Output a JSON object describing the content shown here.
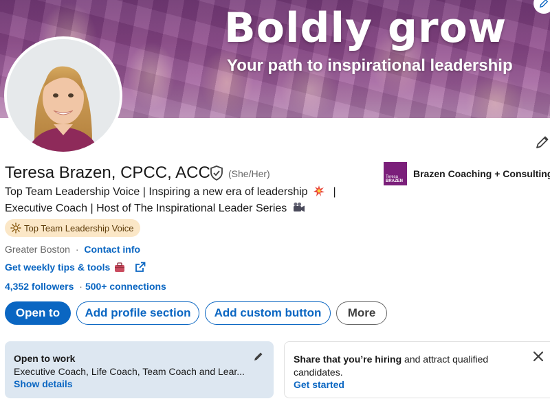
{
  "banner": {
    "title": "Boldly grow",
    "subtitle": "Your path to inspirational leadership"
  },
  "profile": {
    "name": "Teresa Brazen, CPCC, ACC",
    "pronouns": "(She/Her)",
    "headline_line1": "Top Team Leadership Voice | Inspiring a new era of leadership",
    "headline_line1_end": "|",
    "headline_line2": "Executive Coach | Host of The Inspirational Leader Series",
    "badge": "Top Team Leadership Voice",
    "location": "Greater Boston",
    "location_sep": "·",
    "contact_info": "Contact info",
    "tips_link": "Get weekly tips & tools",
    "followers": "4,352 followers",
    "connections_sep": "·",
    "connections": "500+ connections"
  },
  "company": {
    "logo_text_1": "Teresa",
    "logo_text_2": "BRAZEN",
    "name": "Brazen Coaching + Consulting"
  },
  "actions": {
    "open_to": "Open to",
    "add_section": "Add profile section",
    "add_custom": "Add custom button",
    "more": "More"
  },
  "open_to_work": {
    "title": "Open to work",
    "description": "Executive Coach, Life Coach, Team Coach and Lear...",
    "link": "Show details"
  },
  "hiring": {
    "strong_text": "Share that you’re hiring",
    "rest_text": " and attract qualified candidates.",
    "link": "Get started"
  },
  "colors": {
    "brand_blue": "#0a66c2",
    "badge_bg": "#fbe7c7",
    "open_card_bg": "#dde7f1",
    "company_purple": "#7b1f7a"
  },
  "icons": [
    "pencil-icon",
    "verified-shield-icon",
    "sun-badge-icon",
    "explosion-emoji-icon",
    "video-camera-emoji-icon",
    "briefcase-emoji-icon",
    "external-link-icon",
    "close-icon"
  ]
}
